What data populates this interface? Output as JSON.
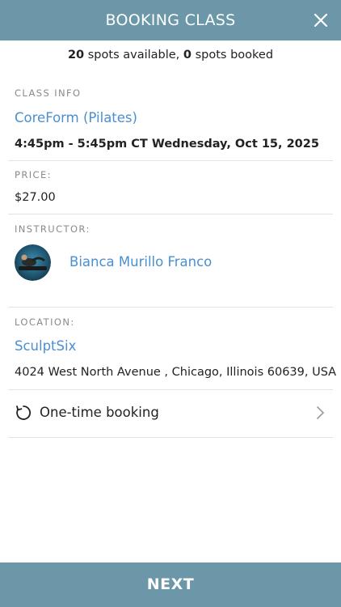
{
  "header": {
    "title": "BOOKING CLASS"
  },
  "spots": {
    "available_count": "20",
    "available_text": "spots available,",
    "booked_count": "0",
    "booked_text": "spots booked"
  },
  "class_info": {
    "label": "CLASS INFO",
    "name": "CoreForm (Pilates)",
    "schedule": "4:45pm - 5:45pm CT Wednesday, Oct 15, 2025"
  },
  "price": {
    "label": "PRICE:",
    "value": "$27.00"
  },
  "instructor": {
    "label": "INSTRUCTOR:",
    "name": "Bianca Murillo Franco"
  },
  "location": {
    "label": "LOCATION:",
    "name": "SculptSix",
    "address": "4024 West North Avenue , Chicago, Illinois 60639, USA"
  },
  "booking": {
    "label": "One-time booking"
  },
  "footer": {
    "next_label": "NEXT"
  },
  "colors": {
    "accent": "#6b97a9",
    "link": "#4a8fd0"
  }
}
